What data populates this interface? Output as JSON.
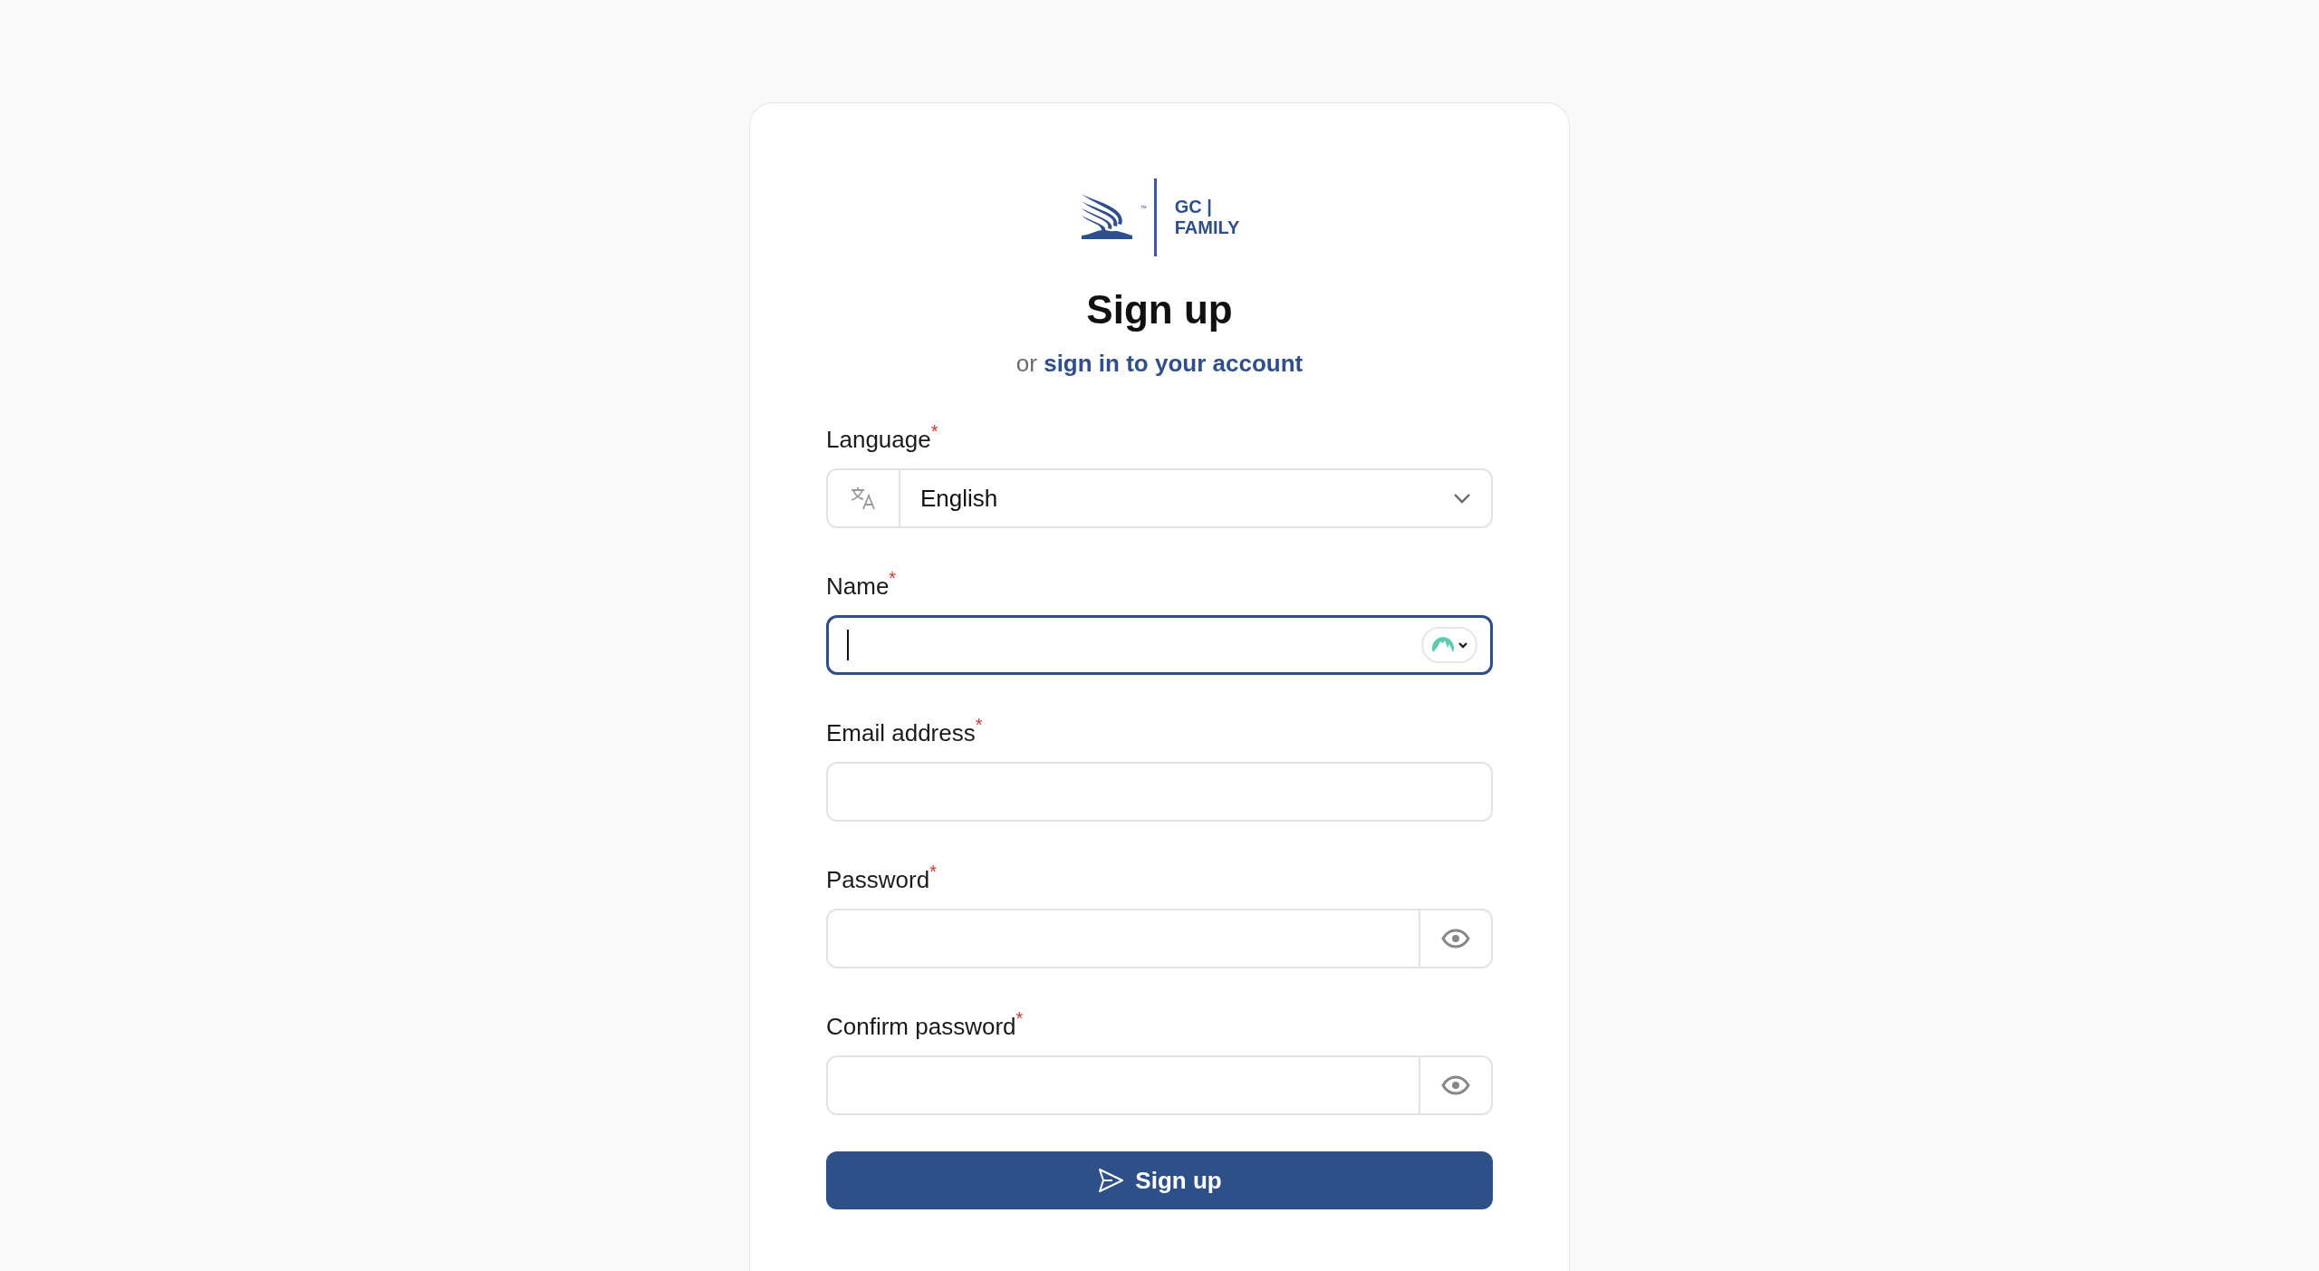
{
  "logo": {
    "trademark": "™",
    "line_1": "GC |",
    "line_2": "FAMILY"
  },
  "heading": "Sign up",
  "subtitle": {
    "prefix": "or",
    "link": "sign in to your account"
  },
  "fields": [
    {
      "kind": "select",
      "label": "Language",
      "required_mark": "*",
      "value": "English",
      "focused": false
    },
    {
      "kind": "text",
      "label": "Name",
      "required_mark": "*",
      "focused": true
    },
    {
      "kind": "text",
      "label": "Email address",
      "required_mark": "*",
      "focused": false
    },
    {
      "kind": "password",
      "label": "Password",
      "required_mark": "*",
      "focused": false
    },
    {
      "kind": "password",
      "label": "Confirm password",
      "required_mark": "*",
      "focused": false
    }
  ],
  "submit": "Sign up"
}
